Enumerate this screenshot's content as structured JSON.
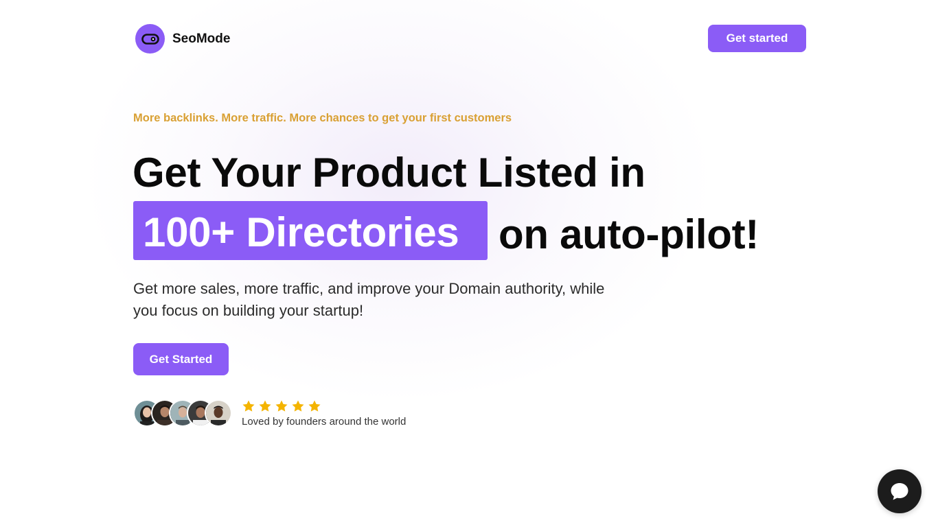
{
  "brand": {
    "name": "SeoMode",
    "logo_icon": "toggle-eye-icon",
    "accent_color": "#8b5cf6"
  },
  "header": {
    "cta_label": "Get started"
  },
  "hero": {
    "tagline": "More backlinks. More traffic. More chances to get your first customers",
    "headline_line1": "Get Your Product Listed in",
    "headline_highlight": "100+ Directories",
    "headline_line2_rest": "on auto-pilot!",
    "subtext": "Get more sales, more traffic, and improve your Domain authority, while you focus on building your startup!",
    "cta_label": "Get Started"
  },
  "social_proof": {
    "avatar_count": 5,
    "rating": 5,
    "rating_max": 5,
    "star_color": "#f4b400",
    "text": "Loved by founders around the world"
  },
  "chat": {
    "icon": "chat-bubble-icon"
  }
}
